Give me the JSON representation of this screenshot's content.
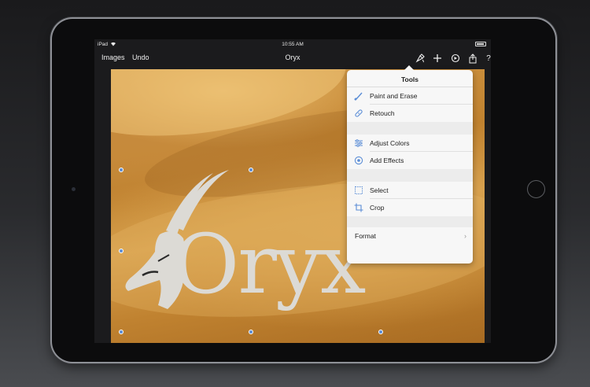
{
  "status_bar": {
    "carrier": "iPad",
    "time": "10:55 AM"
  },
  "nav": {
    "images_label": "Images",
    "undo_label": "Undo",
    "title": "Oryx",
    "help_label": "?"
  },
  "canvas": {
    "logo_text": "Oryx"
  },
  "popover": {
    "title": "Tools",
    "groups": [
      {
        "items": [
          {
            "label": "Paint and Erase",
            "icon": "brush-icon"
          },
          {
            "label": "Retouch",
            "icon": "bandage-icon"
          }
        ]
      },
      {
        "items": [
          {
            "label": "Adjust Colors",
            "icon": "sliders-icon"
          },
          {
            "label": "Add Effects",
            "icon": "effects-icon"
          }
        ]
      },
      {
        "items": [
          {
            "label": "Select",
            "icon": "selection-icon"
          },
          {
            "label": "Crop",
            "icon": "crop-icon"
          }
        ]
      }
    ],
    "format_label": "Format"
  },
  "colors": {
    "accent": "#5b8dd6",
    "popover_bg": "#f7f7f7",
    "sand": "#d49a48"
  }
}
